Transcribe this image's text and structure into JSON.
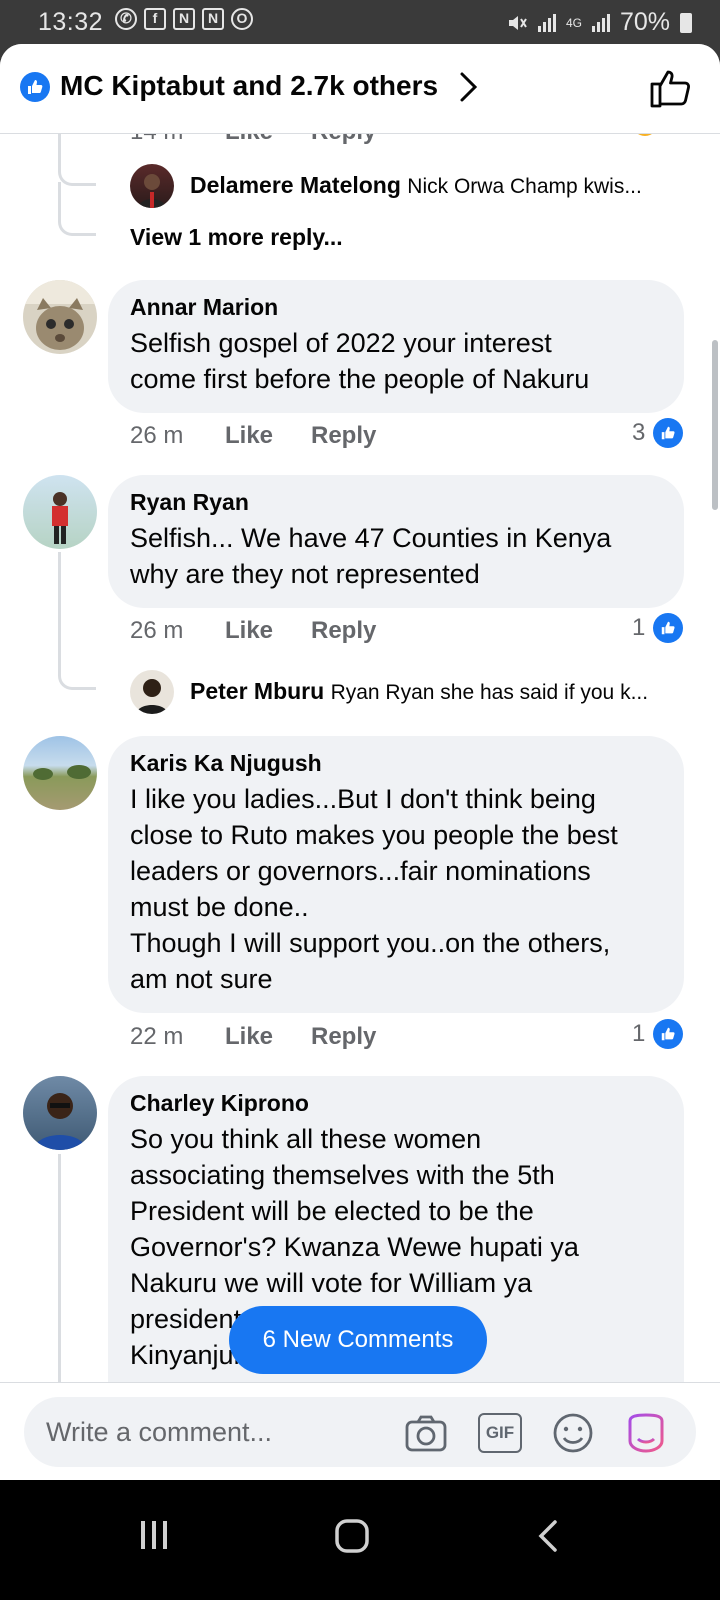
{
  "status_bar": {
    "time": "13:32",
    "battery": "70%",
    "network": "4G"
  },
  "header": {
    "title": "MC Kiptabut and 2.7k others"
  },
  "colors": {
    "accent": "#1877f2",
    "bubble": "#f0f2f5",
    "meta_text": "#65676b"
  },
  "thread_top": {
    "reply_author": "Delamere Matelong",
    "reply_preview": "Nick Orwa Champ kwis...",
    "view_more": "View 1 more reply..."
  },
  "comments": [
    {
      "author": "Annar Marion",
      "text": "Selfish gospel of 2022 your interest\ncome first before the people of Nakuru",
      "time": "26 m",
      "like": "Like",
      "reply": "Reply",
      "reactions": "3"
    },
    {
      "author": "Ryan Ryan",
      "text": "Selfish... We have 47 Counties in Kenya\nwhy are they not represented",
      "time": "26 m",
      "like": "Like",
      "reply": "Reply",
      "reactions": "1",
      "reply_author": "Peter Mburu",
      "reply_preview": "Ryan Ryan she has said if you k..."
    },
    {
      "author": "Karis Ka Njugush",
      "text": "I like you ladies...But I don't think being\nclose to Ruto makes you people the best\nleaders or governors...fair nominations\nmust be done..\nThough I will support you..on the others,\nam not sure",
      "time": "22 m",
      "like": "Like",
      "reply": "Reply",
      "reactions": "1"
    },
    {
      "author": "Charley Kiprono",
      "text": "So you think all these women\nassociating themselves with the 5th\nPresident will be elected to be the\nGovernor's? Kwanza Wewe hupati ya\nNakuru we will vote for William ya\npresident                                     ni Lee\nKinyanjui                                      sasa"
    }
  ],
  "new_comments_label": "6 New Comments",
  "composer": {
    "placeholder": "Write a comment...",
    "gif_label": "GIF"
  }
}
